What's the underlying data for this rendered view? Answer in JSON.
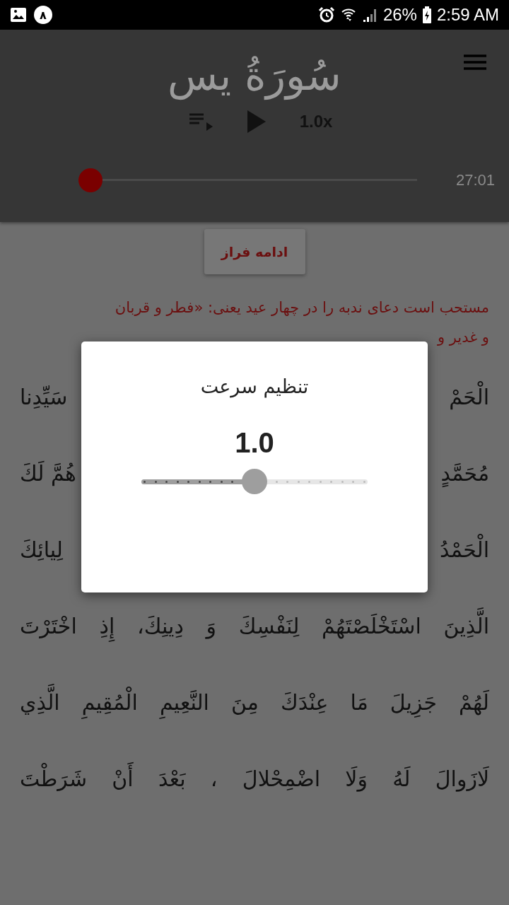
{
  "status_bar": {
    "notification_badge": "٨",
    "battery": "26%",
    "time": "2:59 AM"
  },
  "header": {
    "title": "سُورَةُ يس",
    "speed": "1.0x",
    "seek": {
      "level": 0
    },
    "duration": "27:01"
  },
  "continue_button": "ادامه فراز",
  "intro": [
    "مستحب است دعای ندبه را در چهار عید یعنی: «فطر و قربان",
    "و غدیر و"
  ],
  "verses": [
    {
      "kind": "split",
      "right": "الْحَمْ",
      "left": "سَيِّدِنا"
    },
    {
      "kind": "split",
      "right": "مُحَمَّدٍ",
      "left": "هُمَّ لَكَ"
    },
    {
      "kind": "split",
      "right": "الْحَمْدُ",
      "left": "لِيائِكَ"
    },
    {
      "kind": "full",
      "text": "الَّذِينَ اسْتَخْلَصْتَهُمْ لِنَفْسِكَ وَ دِينِكَ، إِذِ اخْتَرْتَ"
    },
    {
      "kind": "full",
      "text": "لَهُمْ جَزِيلَ مَا عِنْدَكَ مِنَ النَّعِيمِ الْمُقِيمِ الَّذِي"
    },
    {
      "kind": "full",
      "text": "لَازَوالَ لَهُ وَلَا اضْمِحْلالَ ، بَعْدَ أَنْ شَرَطْتَ"
    }
  ],
  "dialog": {
    "title": "تنظیم سرعت",
    "value": "1.0",
    "slider": {
      "level": 0.5
    }
  }
}
